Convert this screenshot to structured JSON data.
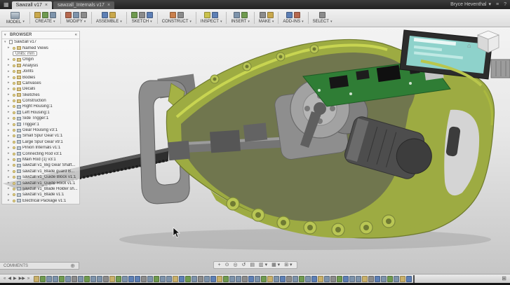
{
  "glyphs": {
    "apps": "▦",
    "close": "×",
    "caret_down": "▾",
    "caret_right": "▸",
    "collapse": "«",
    "add": "⊕",
    "home": "⌂",
    "help": "?",
    "menu": "≡",
    "options": "⊞"
  },
  "titlebar": {
    "tabs": [
      {
        "label": "Sawzall v17",
        "active": true
      },
      {
        "label": "sawzall_Internals v17",
        "active": false
      }
    ],
    "user_name": "Bryce Heventhal"
  },
  "toolbar": {
    "workspace_label": "MODEL",
    "menus": [
      {
        "label": "CREATE",
        "icons": [
          "#c9a84c",
          "#6f9a4f",
          "#7d93ab"
        ]
      },
      {
        "label": "MODIFY",
        "icons": [
          "#b5684f",
          "#7d93ab",
          "#8b8b8b"
        ]
      },
      {
        "label": "ASSEMBLE",
        "icons": [
          "#5d7fb5",
          "#c9a84c"
        ]
      },
      {
        "label": "SKETCH",
        "icons": [
          "#6f9a4f",
          "#8b8b8b",
          "#5d7fb5"
        ]
      },
      {
        "label": "CONSTRUCT",
        "icons": [
          "#c97f4c",
          "#8b8b8b"
        ]
      },
      {
        "label": "INSPECT",
        "icons": [
          "#c9c14c",
          "#5d7fb5"
        ]
      },
      {
        "label": "INSERT",
        "icons": [
          "#7d93ab",
          "#6f9a4f"
        ]
      },
      {
        "label": "MAKE",
        "icons": [
          "#8b8b8b",
          "#c9a84c"
        ]
      },
      {
        "label": "ADD-INS",
        "icons": [
          "#5d7fb5",
          "#b5684f"
        ]
      },
      {
        "label": "SELECT",
        "icons": [
          "#8b8b8b"
        ]
      }
    ]
  },
  "browser": {
    "title": "BROWSER",
    "root_label": "Sawzall v17",
    "items": [
      {
        "label": "Named Views",
        "icon": "folder"
      },
      {
        "label": "Units: mm",
        "icon": "units"
      },
      {
        "label": "Origin",
        "icon": "folder"
      },
      {
        "label": "Analysis",
        "icon": "folder"
      },
      {
        "label": "Joints",
        "icon": "folder"
      },
      {
        "label": "Bodies",
        "icon": "folder"
      },
      {
        "label": "Canvases",
        "icon": "folder"
      },
      {
        "label": "Decals",
        "icon": "folder"
      },
      {
        "label": "Sketches",
        "icon": "folder"
      },
      {
        "label": "Construction",
        "icon": "folder"
      },
      {
        "label": "Right Housing:1",
        "icon": "component"
      },
      {
        "label": "Left Housing:1",
        "icon": "component"
      },
      {
        "label": "Side Trigger:1",
        "icon": "component"
      },
      {
        "label": "Trigger:1",
        "icon": "component"
      },
      {
        "label": "Gear Housing v3:1",
        "icon": "component"
      },
      {
        "label": "Small Spur Gear v1:1",
        "icon": "component"
      },
      {
        "label": "Large Spur Gear v9:1",
        "icon": "component"
      },
      {
        "label": "Pinion Internals v1:1",
        "icon": "component"
      },
      {
        "label": "Connecting Rod v3:1",
        "icon": "component"
      },
      {
        "label": "Main Rod (1) v3:1",
        "icon": "component"
      },
      {
        "label": "sawzall v1_Big Gear Shaft...",
        "icon": "component"
      },
      {
        "label": "sawzall v1_Blade guard B...",
        "icon": "component"
      },
      {
        "label": "sawzall v1_Guide Block v1:1",
        "icon": "component"
      },
      {
        "label": "sawzall v1_Guide Rock v1:1",
        "icon": "component"
      },
      {
        "label": "sawzall v1_Blade Holder sh...",
        "icon": "component"
      },
      {
        "label": "sawzall v1_Blade v1:1",
        "icon": "component"
      },
      {
        "label": "Electrical Package v1:1",
        "icon": "component"
      }
    ]
  },
  "navbar": {
    "icons": [
      {
        "name": "pan-icon",
        "glyph": "+"
      },
      {
        "name": "zoom-icon",
        "glyph": "⊙"
      },
      {
        "name": "fit-view-icon",
        "glyph": "◎"
      },
      {
        "name": "orbit-icon",
        "glyph": "↺"
      },
      {
        "name": "look-at-icon",
        "glyph": "▤"
      },
      {
        "name": "display-settings-icon",
        "glyph": "▥ ▾"
      },
      {
        "name": "grid-settings-icon",
        "glyph": "▦ ▾"
      },
      {
        "name": "viewports-icon",
        "glyph": "⊞ ▾"
      }
    ]
  },
  "comments": {
    "label": "COMMENTS"
  },
  "timeline": {
    "playback": [
      {
        "name": "skip-to-start-button",
        "glyph": "«"
      },
      {
        "name": "step-back-button",
        "glyph": "◀"
      },
      {
        "name": "play-button",
        "glyph": "▶"
      },
      {
        "name": "step-forward-button",
        "glyph": "▶▶"
      },
      {
        "name": "skip-to-end-button",
        "glyph": "»"
      }
    ],
    "op_colors": {
      "s": "#6f9a4f",
      "e": "#7d93ab",
      "c": "#c9b06a",
      "j": "#5d7fb5",
      "f": "#8b8b8b"
    },
    "ops": [
      "c",
      "s",
      "e",
      "e",
      "s",
      "e",
      "f",
      "e",
      "s",
      "e",
      "e",
      "f",
      "c",
      "s",
      "e",
      "j",
      "j",
      "f",
      "e",
      "s",
      "e",
      "e",
      "c",
      "j",
      "s",
      "e",
      "f",
      "e",
      "j",
      "c",
      "s",
      "e",
      "e",
      "f",
      "j",
      "e",
      "s",
      "c",
      "e",
      "j",
      "f",
      "e",
      "s",
      "e",
      "j",
      "c",
      "e",
      "f",
      "s",
      "j",
      "e",
      "e",
      "c",
      "f",
      "j",
      "e",
      "s",
      "e",
      "c",
      "j"
    ]
  }
}
